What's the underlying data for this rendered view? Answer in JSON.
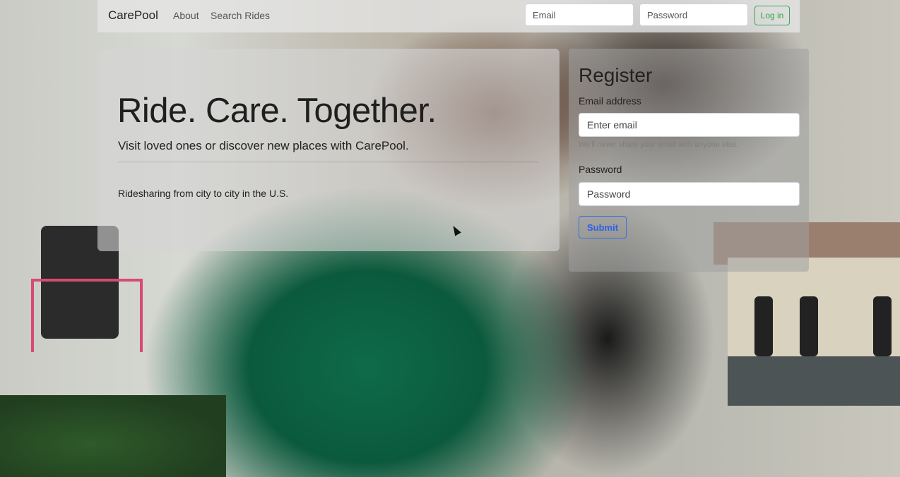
{
  "navbar": {
    "brand": "CarePool",
    "links": [
      "About",
      "Search Rides"
    ],
    "email_placeholder": "Email",
    "password_placeholder": "Password",
    "login_label": "Log in"
  },
  "hero": {
    "title": "Ride. Care. Together.",
    "lead": "Visit loved ones or discover new places with CarePool.",
    "subtext": "Ridesharing from city to city in the U.S."
  },
  "register": {
    "title": "Register",
    "email_label": "Email address",
    "email_placeholder": "Enter email",
    "email_help": "We'll never share your email with anyone else.",
    "password_label": "Password",
    "password_placeholder": "Password",
    "submit_label": "Submit"
  },
  "colors": {
    "login_accent": "#28a745",
    "submit_accent": "#2a62e8",
    "sweater": "#0e6b4a"
  }
}
